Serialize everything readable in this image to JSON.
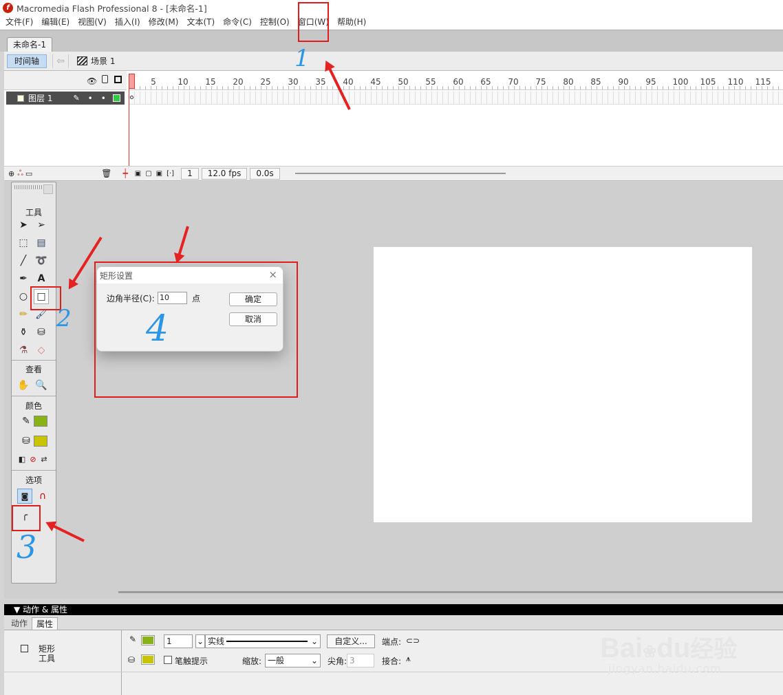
{
  "titlebar": {
    "title": "Macromedia Flash Professional 8 - [未命名-1]",
    "logo_glyph": "f"
  },
  "menubar": [
    "文件(F)",
    "编辑(E)",
    "视图(V)",
    "插入(I)",
    "修改(M)",
    "文本(T)",
    "命令(C)",
    "控制(O)",
    "窗口(W)",
    "帮助(H)"
  ],
  "doc_tab": "未命名-1",
  "navbar": {
    "timeline_button": "时间轴",
    "scene": "场景 1"
  },
  "timeline": {
    "ruler_ticks": [
      "1",
      "5",
      "10",
      "15",
      "20",
      "25",
      "30",
      "35",
      "40",
      "45",
      "50",
      "55",
      "60",
      "65",
      "70",
      "75",
      "80",
      "85",
      "90",
      "95",
      "100",
      "105",
      "110",
      "115"
    ],
    "layer_name": "图层 1",
    "footer": {
      "frame": "1",
      "fps": "12.0 fps",
      "time": "0.0s"
    }
  },
  "toolbar": {
    "sections": {
      "tools": "工具",
      "view": "查看",
      "colors": "颜色",
      "options": "选项"
    },
    "text_tool_glyph": "A"
  },
  "dialog": {
    "title": "矩形设置",
    "close": "×",
    "corner_radius_label": "边角半径(C):",
    "corner_radius_value": "10",
    "unit": "点",
    "ok": "确定",
    "cancel": "取消"
  },
  "annotations": {
    "num1": "1",
    "num2": "2",
    "num3": "3",
    "num4": "4",
    "color": "#e01d1d",
    "hand_color": "#2b96e6"
  },
  "panel": {
    "header": "▼ 动作 & 属性",
    "tabs": [
      "动作",
      "属性"
    ],
    "tool_name_line1": "矩形",
    "tool_name_line2": "工具",
    "stroke_width": "1",
    "stroke_style": "实线",
    "custom_button": "自定义...",
    "cap_label": "端点:",
    "stroke_hint_label": "笔触提示",
    "scale_label": "缩放:",
    "scale_value": "一般",
    "miter_label": "尖角:",
    "miter_value": "3",
    "join_label": "接合:",
    "stroke_color": "#88b317",
    "fill_color": "#c8c400"
  },
  "watermark": {
    "brand": "Bai",
    "brand2": "du",
    "cn": "经验",
    "url": "jingyan.baidu.com"
  }
}
